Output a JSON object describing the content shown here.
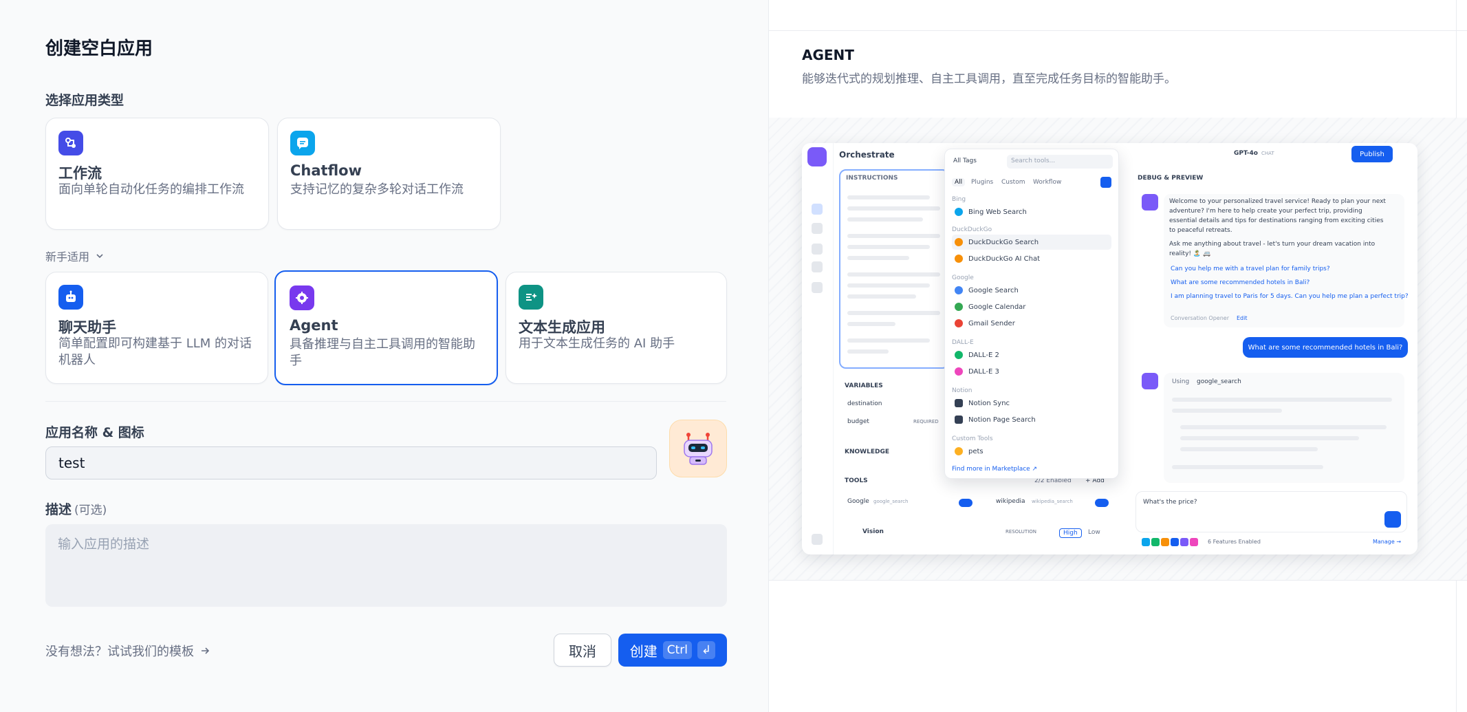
{
  "page": {
    "title": "创建空白应用",
    "type_label": "选择应用类型",
    "beginner_label": "新手适用"
  },
  "app_types": {
    "workflow": {
      "title": "工作流",
      "desc": "面向单轮自动化任务的编排工作流",
      "color": "#444ce7"
    },
    "chatflow": {
      "title": "Chatflow",
      "desc": "支持记忆的复杂多轮对话工作流",
      "color": "#0ba5ec"
    },
    "chatbot": {
      "title": "聊天助手",
      "desc": "简单配置即可构建基于 LLM 的对话机器人",
      "color": "#155eef"
    },
    "agent": {
      "title": "Agent",
      "desc": "具备推理与自主工具调用的智能助手",
      "color": "#7839ee",
      "selected": true
    },
    "completion": {
      "title": "文本生成应用",
      "desc": "用于文本生成任务的 AI 助手",
      "color": "#0e9384"
    }
  },
  "form": {
    "name_label": "应用名称 & 图标",
    "name_value": "test",
    "desc_label": "描述",
    "desc_optional": "(可选)",
    "desc_placeholder": "输入应用的描述"
  },
  "footer": {
    "template_link": "没有想法？试试我们的模板",
    "cancel_label": "取消",
    "create_label": "创建",
    "shortcut_ctrl": "Ctrl",
    "shortcut_enter": "↲"
  },
  "preview": {
    "title": "AGENT",
    "desc": "能够迭代式的规划推理、自主工具调用，直至完成任务目标的智能助手。",
    "mock": {
      "orchestrate": "Orchestrate",
      "instructions": "INSTRUCTIONS",
      "variables": "VARIABLES",
      "var1": "destination",
      "var2": "budget",
      "required": "REQUIRED",
      "knowledge": "KNOWLEDGE",
      "tools": "TOOLS",
      "tools_enabled": "2/2 Enabled",
      "add": "+ Add",
      "tool1": "Google",
      "tool1_sub": "google_search",
      "tool2": "wikipedia",
      "tool2_sub": "wikipedia_search",
      "vision": "Vision",
      "resolution": "RESOLUTION",
      "high": "High",
      "low": "Low",
      "all_tags": "All Tags",
      "search_tools": "Search tools...",
      "tab_all": "All",
      "tab_plugins": "Plugins",
      "tab_custom": "Custom",
      "tab_workflow": "Workflow",
      "grp_bing": "Bing",
      "item_bing": "Bing Web Search",
      "grp_ddg": "DuckDuckGo",
      "item_ddg1": "DuckDuckGo Search",
      "item_ddg2": "DuckDuckGo AI Chat",
      "grp_google": "Google",
      "item_g1": "Google Search",
      "item_g2": "Google Calendar",
      "item_g3": "Gmail Sender",
      "grp_dalle": "DALL-E",
      "item_d1": "DALL-E 2",
      "item_d2": "DALL-E 3",
      "grp_notion": "Notion",
      "item_n1": "Notion Sync",
      "item_n2": "Notion Page Search",
      "grp_custom": "Custom Tools",
      "item_c1": "pets",
      "marketplace": "Find more in Marketplace ↗",
      "model": "GPT-4o",
      "model_tag": "CHAT",
      "publish": "Publish",
      "debug": "DEBUG & PREVIEW",
      "welcome1": "Welcome to your personalized travel service! Ready to plan your next",
      "welcome2": "adventure? I'm here to help create your perfect trip, providing",
      "welcome3": "essential details and tips for destinations ranging from exciting cities",
      "welcome4": "to peaceful retreats.",
      "ask1": "Ask me anything about travel - let's turn your dream vacation into",
      "ask2": "reality! 🏝️ 🚐",
      "sugg1": "Can you help me with a travel plan for family trips?",
      "sugg2": "What are some recommended hotels in Bali?",
      "sugg3": "I am planning travel to Paris for 5 days. Can you help me plan a perfect trip?",
      "opener": "Conversation Opener",
      "edit": "Edit",
      "user_msg": "What are some recommended hotels in Bali?",
      "using": "Using",
      "using_tool": "google_search",
      "input_text": "What's the price?",
      "features": "6 Features Enabled",
      "manage": "Manage →"
    }
  }
}
